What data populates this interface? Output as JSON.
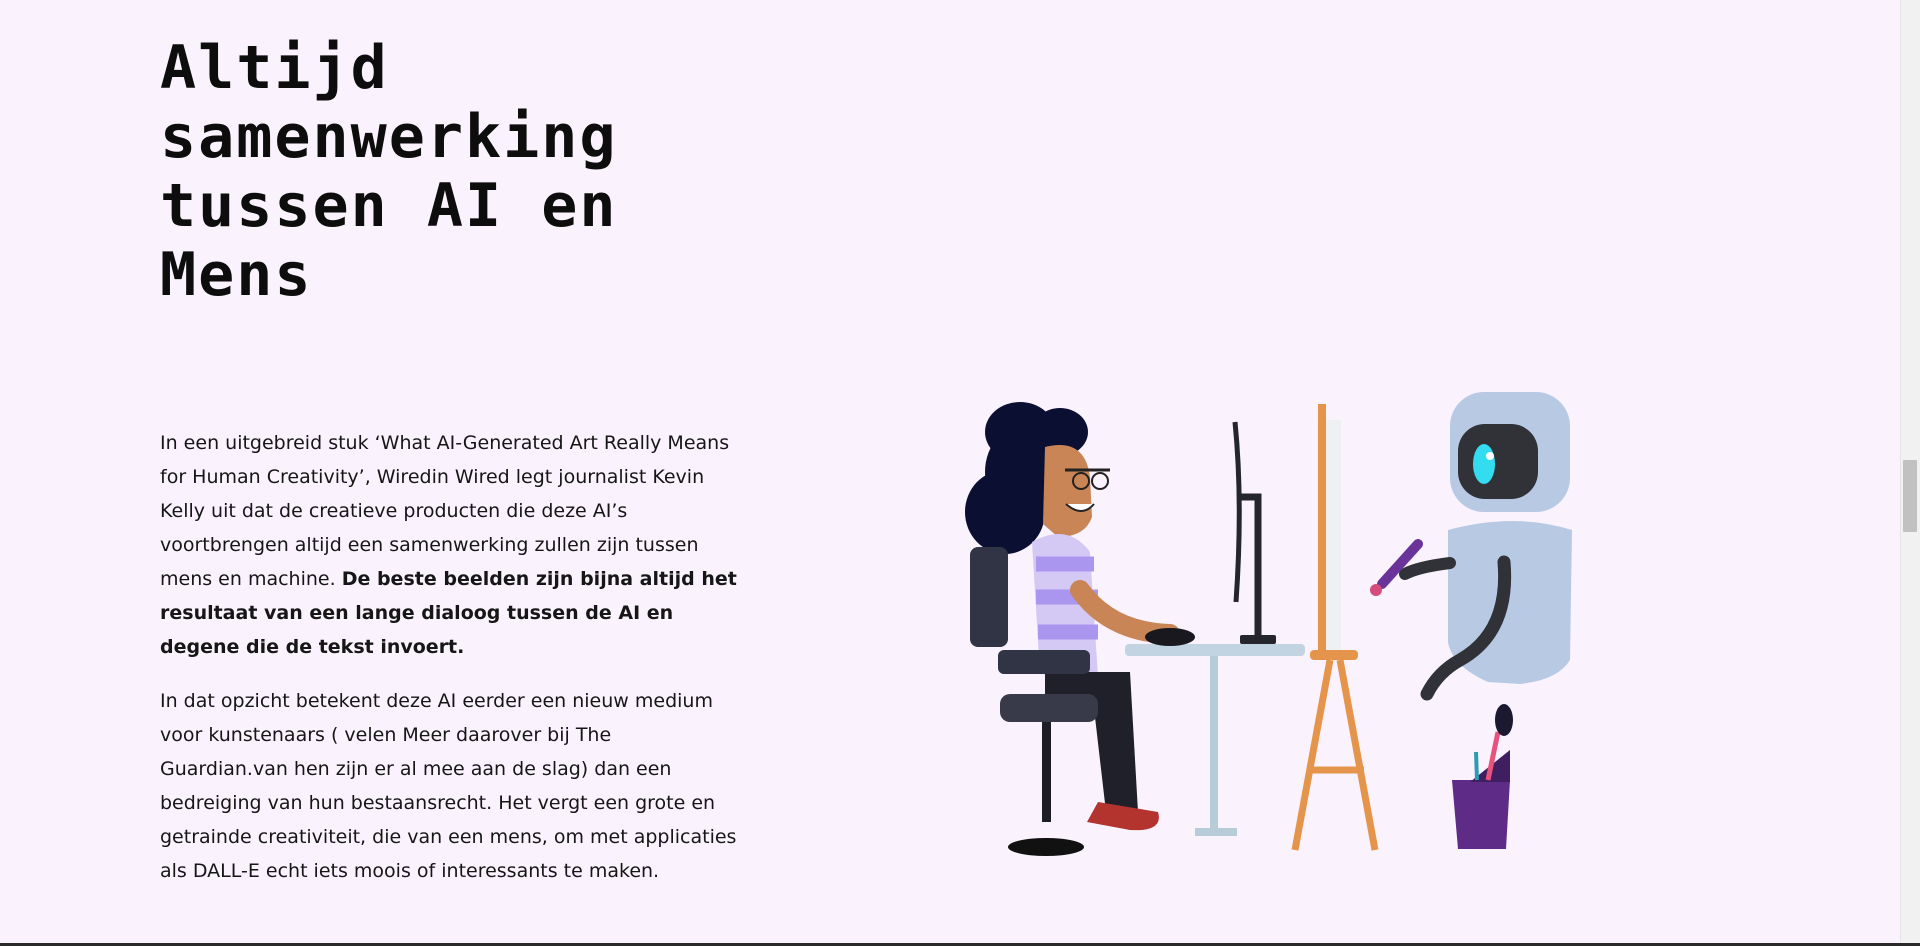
{
  "headline": "Altijd samenwerking tussen AI en Mens",
  "article": {
    "paragraph_1_text": "In een uitgebreid stuk ‘What AI-Generated Art Really Means for Human Creativity’, Wiredin Wired legt journalist Kevin Kelly uit dat de creatieve producten die deze AI’s voortbrengen altijd een samenwerking zullen zijn tussen mens en machine. ",
    "paragraph_1_bold": "De beste beelden zijn bijna altijd het resultaat van een lange dialoog tussen de AI en degene die de tekst invoert.",
    "paragraph_2_text": "In dat opzicht betekent deze AI eerder een nieuw medium voor kunstenaars ( velen Meer daarover bij The Guardian.van hen zijn er al mee aan de slag) dan een bedreiging van hun bestaansrecht. Het vergt een grote en getrainde creativiteit, die van een mens, om met applicaties als DALL-E echt iets moois of interessants te maken."
  },
  "colors": {
    "background": "#faf2fd",
    "robot": "#b8cae3",
    "easel": "#e4954b",
    "cup": "#5e2c86"
  },
  "illustration": {
    "scene": "woman at computer and robot painting on easel",
    "icons": [
      "woman-character",
      "desk",
      "monitor",
      "easel",
      "robot",
      "paint-cup"
    ]
  }
}
